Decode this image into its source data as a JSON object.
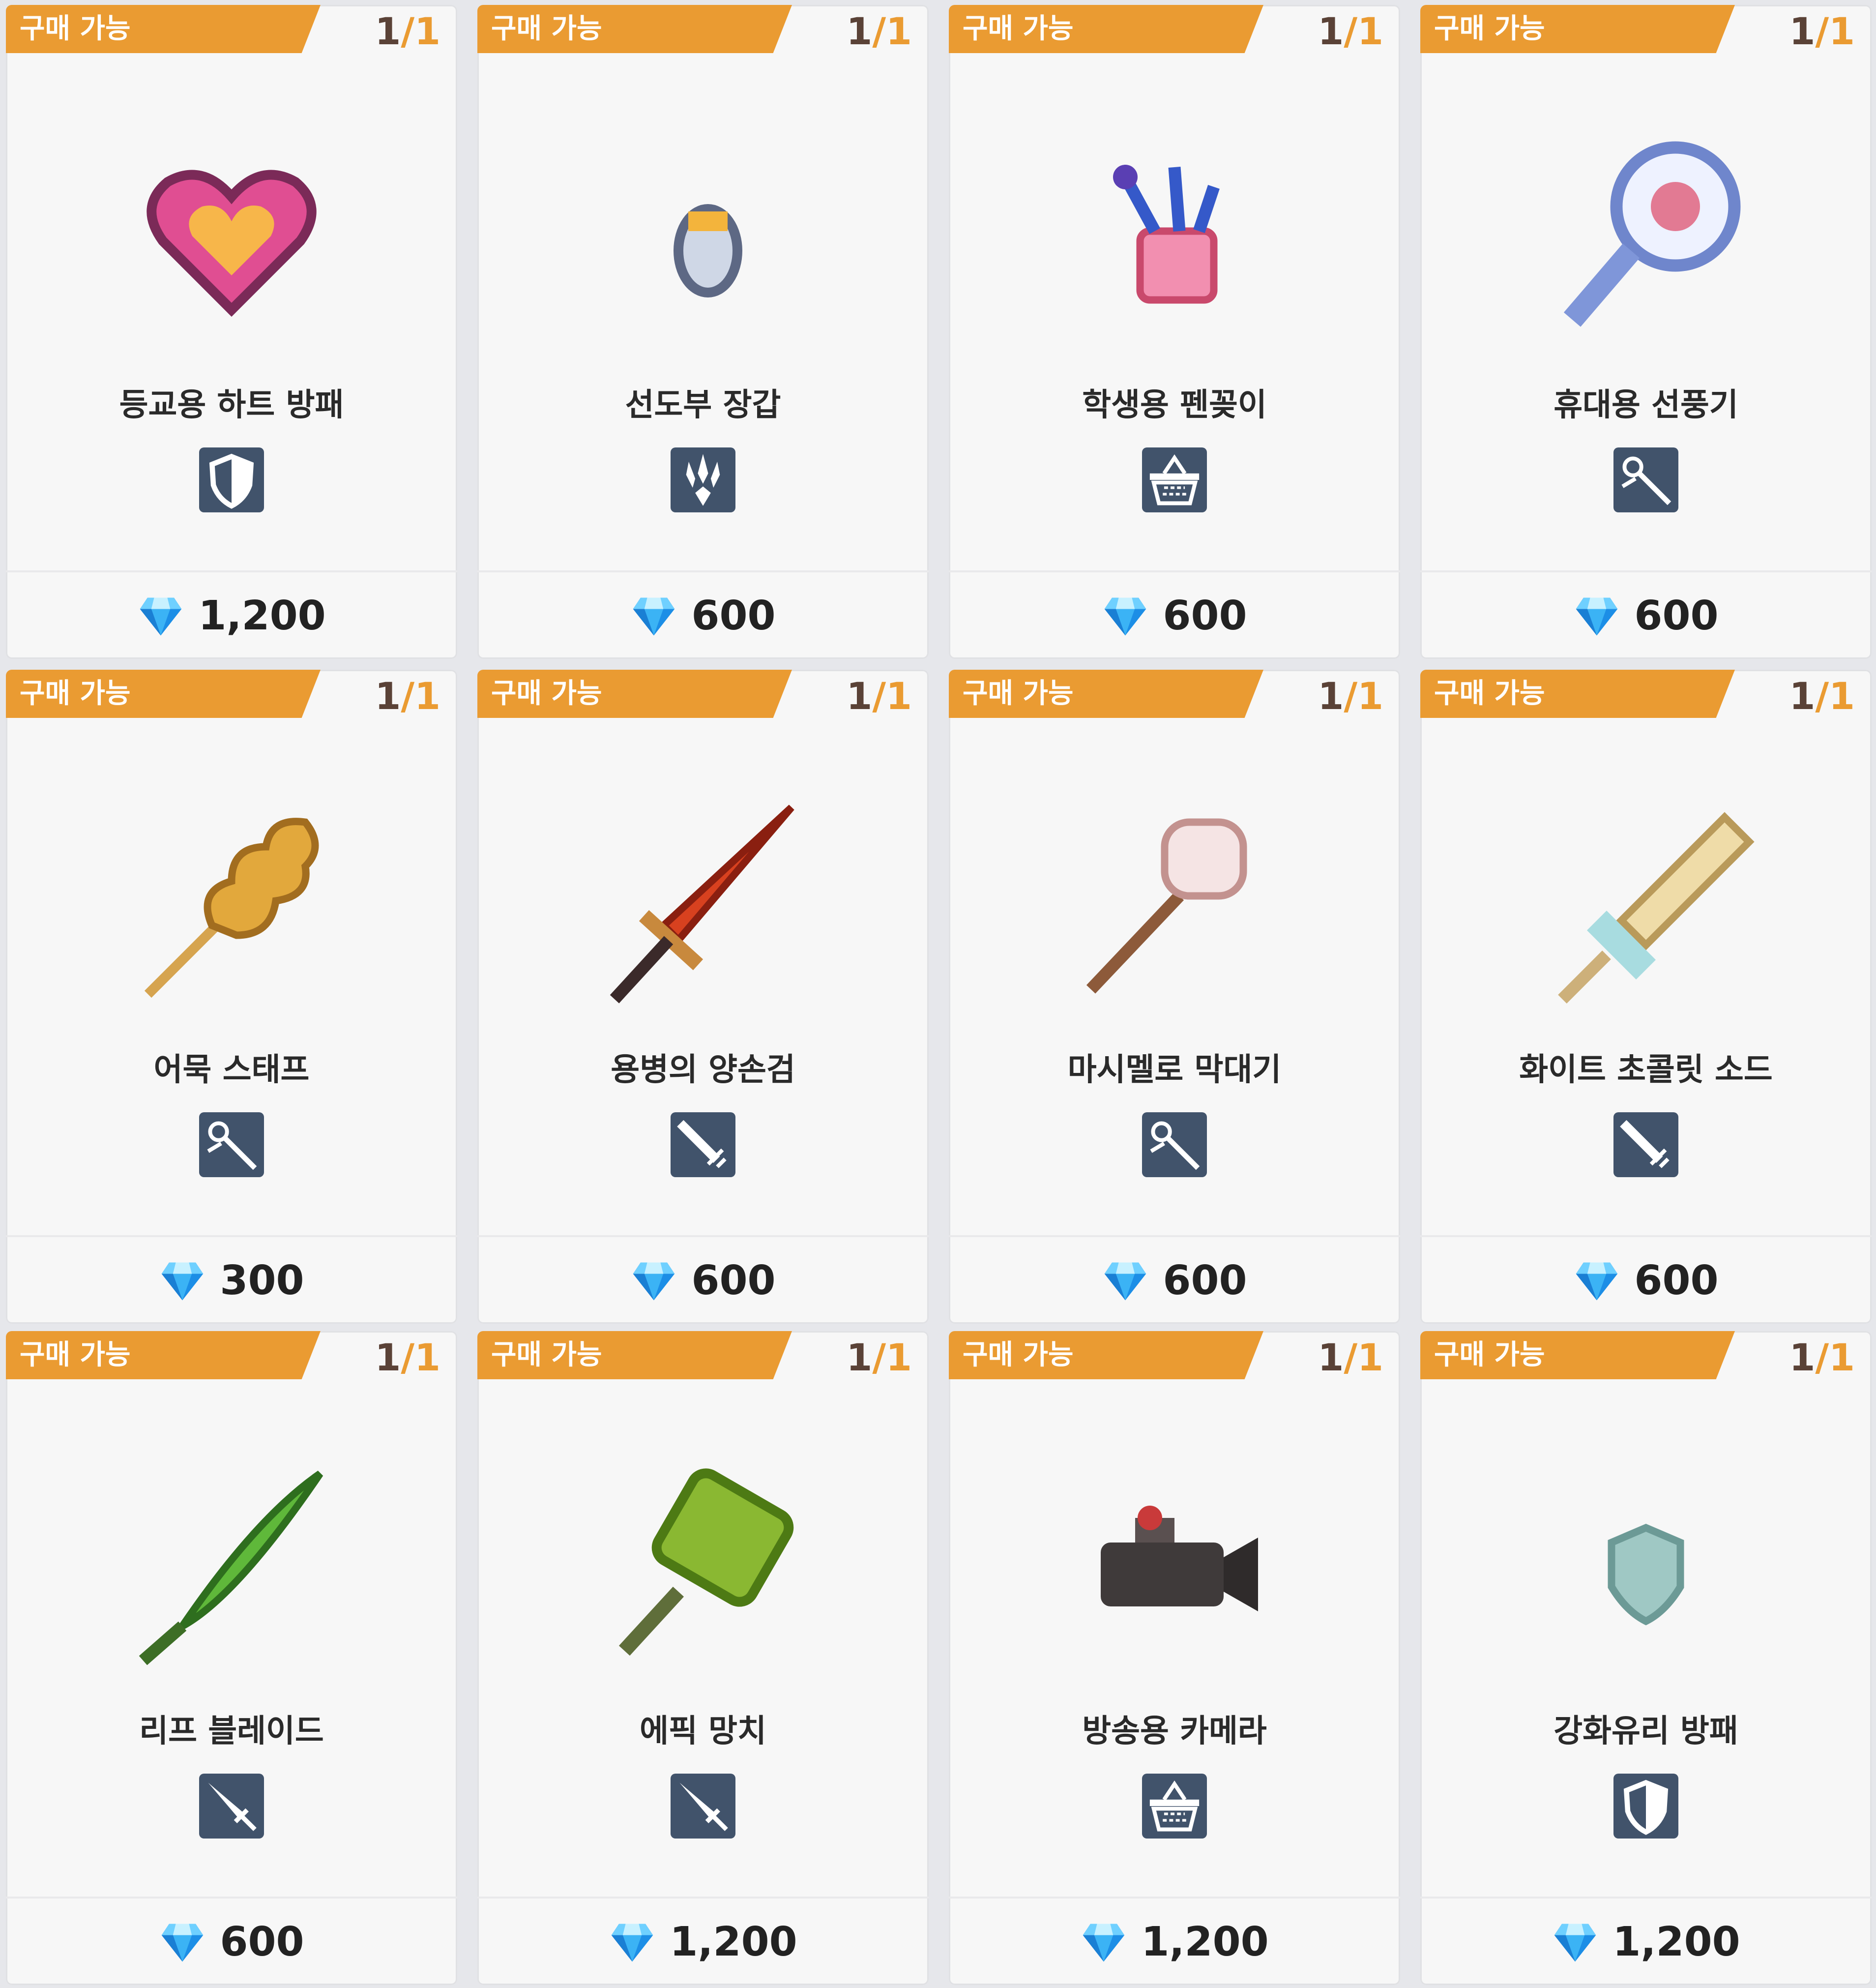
{
  "badge": {
    "label": "구매 가능"
  },
  "colors": {
    "badge": "#ea9b32",
    "stock_current": "#5a4237",
    "category_bg": "#41536b",
    "card_bg": "#f7f7f7",
    "gem": "#2aa7f0"
  },
  "cards": [
    {
      "name": "등교용 하트 방패",
      "price": "1,200",
      "stock_current": "1",
      "stock_max": "1",
      "item_icon": "heart-shield-icon",
      "category_icon": "shield-icon"
    },
    {
      "name": "선도부 장갑",
      "price": "600",
      "stock_current": "1",
      "stock_max": "1",
      "item_icon": "glove-icon",
      "category_icon": "claw-icon"
    },
    {
      "name": "학생용 펜꽂이",
      "price": "600",
      "stock_current": "1",
      "stock_max": "1",
      "item_icon": "pen-holder-icon",
      "category_icon": "basket-icon"
    },
    {
      "name": "휴대용 선풍기",
      "price": "600",
      "stock_current": "1",
      "stock_max": "1",
      "item_icon": "handheld-fan-icon",
      "category_icon": "wand-icon"
    },
    {
      "name": "어묵 스태프",
      "price": "300",
      "stock_current": "1",
      "stock_max": "1",
      "item_icon": "fishcake-staff-icon",
      "category_icon": "wand-icon"
    },
    {
      "name": "용병의 양손검",
      "price": "600",
      "stock_current": "1",
      "stock_max": "1",
      "item_icon": "greatsword-icon",
      "category_icon": "greatsword-category-icon"
    },
    {
      "name": "마시멜로 막대기",
      "price": "600",
      "stock_current": "1",
      "stock_max": "1",
      "item_icon": "marshmallow-stick-icon",
      "category_icon": "wand-icon"
    },
    {
      "name": "화이트 초콜릿 소드",
      "price": "600",
      "stock_current": "1",
      "stock_max": "1",
      "item_icon": "chocolate-sword-icon",
      "category_icon": "greatsword-category-icon"
    },
    {
      "name": "리프 블레이드",
      "price": "600",
      "stock_current": "1",
      "stock_max": "1",
      "item_icon": "leaf-blade-icon",
      "category_icon": "sword-icon"
    },
    {
      "name": "에픽 망치",
      "price": "1,200",
      "stock_current": "1",
      "stock_max": "1",
      "item_icon": "epic-hammer-icon",
      "category_icon": "sword-icon"
    },
    {
      "name": "방송용 카메라",
      "price": "1,200",
      "stock_current": "1",
      "stock_max": "1",
      "item_icon": "camcorder-icon",
      "category_icon": "basket-icon"
    },
    {
      "name": "강화유리 방패",
      "price": "1,200",
      "stock_current": "1",
      "stock_max": "1",
      "item_icon": "glass-shield-icon",
      "category_icon": "shield-icon"
    }
  ]
}
